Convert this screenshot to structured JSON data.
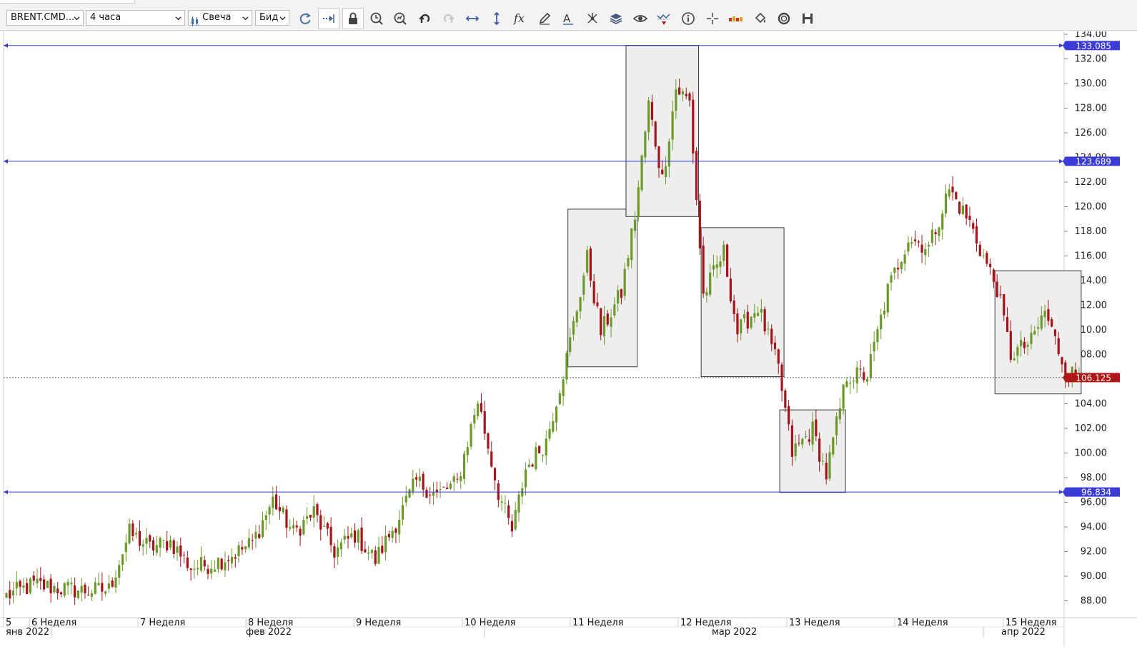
{
  "toolbar": {
    "instrument": "BRENT.CMD...",
    "timeframe": "4 часа",
    "chart_type": "Свеча",
    "price_side": "Бид",
    "icons": [
      "refresh-icon",
      "shift-icon",
      "lock-icon",
      "zoom-time-icon",
      "zoom-fit-icon",
      "undo-icon",
      "redo-icon",
      "horizontal-arrows-icon",
      "vertical-arrows-icon",
      "formula-icon",
      "pencil-icon",
      "text-icon",
      "network-icon",
      "layers-icon",
      "eye-icon",
      "chart-alert-icon",
      "info-icon",
      "crosshair-icon",
      "color-bar-icon",
      "paint-bucket-icon",
      "sync-icon",
      "save-icon"
    ]
  },
  "chart_data": {
    "type": "candlestick",
    "instrument": "BRENT.CMD...",
    "timeframe": "4 часа",
    "ylim": [
      86.5,
      135.0
    ],
    "y_ticks": [
      "134.00",
      "132.00",
      "130.00",
      "128.00",
      "126.00",
      "124.00",
      "122.00",
      "120.00",
      "118.00",
      "116.00",
      "114.00",
      "112.00",
      "110.00",
      "108.00",
      "106.00",
      "104.00",
      "102.00",
      "100.00",
      "98.00",
      "96.00",
      "94.00",
      "92.00",
      "90.00",
      "88.00"
    ],
    "week_labels": [
      "5",
      "6 Неделя",
      "7 Неделя",
      "8 Неделя",
      "9 Неделя",
      "10 Неделя",
      "11 Неделя",
      "12 Неделя",
      "13 Неделя",
      "14 Неделя",
      "15 Неделя"
    ],
    "month_labels": [
      "янв 2022",
      "фев 2022",
      "мар 2022",
      "апр 2022"
    ],
    "horizontal_levels": [
      {
        "label": "133.085",
        "value": 133.085,
        "color": "#3b3bd8"
      },
      {
        "label": "123.689",
        "value": 123.689,
        "color": "#3b3bd8"
      },
      {
        "label": "96.834",
        "value": 96.834,
        "color": "#3b3bd8"
      }
    ],
    "current_price": {
      "label": "106.125",
      "value": 106.125,
      "color": "#b01616"
    },
    "zones": [
      {
        "from_bar": 165,
        "to_bar": 184,
        "low": 107.0,
        "high": 119.8
      },
      {
        "from_bar": 182,
        "to_bar": 202,
        "low": 119.2,
        "high": 133.1
      },
      {
        "from_bar": 204,
        "to_bar": 227,
        "low": 106.2,
        "high": 118.3
      },
      {
        "from_bar": 227,
        "to_bar": 245,
        "low": 96.8,
        "high": 103.5
      },
      {
        "from_bar": 290,
        "to_bar": 314,
        "low": 104.8,
        "high": 114.8
      }
    ],
    "bars": 316,
    "x_start": "янв 2022",
    "x_end": "апр 2022",
    "colors": {
      "up": "#6b9a2a",
      "down": "#a4141a"
    },
    "anchors": [
      [
        0,
        88.4
      ],
      [
        8,
        89.3
      ],
      [
        16,
        89.0
      ],
      [
        24,
        88.8
      ],
      [
        30,
        88.9
      ],
      [
        36,
        93.5
      ],
      [
        42,
        92.3
      ],
      [
        48,
        92.8
      ],
      [
        54,
        90.7
      ],
      [
        60,
        91.0
      ],
      [
        66,
        91.7
      ],
      [
        72,
        92.7
      ],
      [
        78,
        96.2
      ],
      [
        84,
        93.5
      ],
      [
        90,
        95.2
      ],
      [
        96,
        92.0
      ],
      [
        102,
        93.4
      ],
      [
        108,
        91.3
      ],
      [
        114,
        94.3
      ],
      [
        120,
        97.7
      ],
      [
        126,
        96.6
      ],
      [
        132,
        97.6
      ],
      [
        138,
        104.3
      ],
      [
        144,
        96.8
      ],
      [
        148,
        93.6
      ],
      [
        152,
        98.7
      ],
      [
        158,
        101.0
      ],
      [
        164,
        107.7
      ],
      [
        170,
        115.8
      ],
      [
        174,
        109.8
      ],
      [
        180,
        113.0
      ],
      [
        184,
        119.3
      ],
      [
        188,
        128.3
      ],
      [
        192,
        122.2
      ],
      [
        196,
        129.6
      ],
      [
        200,
        128.5
      ],
      [
        204,
        112.8
      ],
      [
        210,
        116.3
      ],
      [
        214,
        109.8
      ],
      [
        220,
        111.9
      ],
      [
        226,
        106.8
      ],
      [
        230,
        100.0
      ],
      [
        236,
        101.9
      ],
      [
        240,
        98.2
      ],
      [
        246,
        106.3
      ],
      [
        252,
        106.3
      ],
      [
        258,
        113.2
      ],
      [
        264,
        117.5
      ],
      [
        270,
        116.7
      ],
      [
        276,
        121.4
      ],
      [
        282,
        118.7
      ],
      [
        286,
        115.9
      ],
      [
        290,
        113.4
      ],
      [
        294,
        108.0
      ],
      [
        300,
        109.0
      ],
      [
        304,
        111.5
      ],
      [
        310,
        106.8
      ],
      [
        314,
        106.1
      ]
    ]
  }
}
